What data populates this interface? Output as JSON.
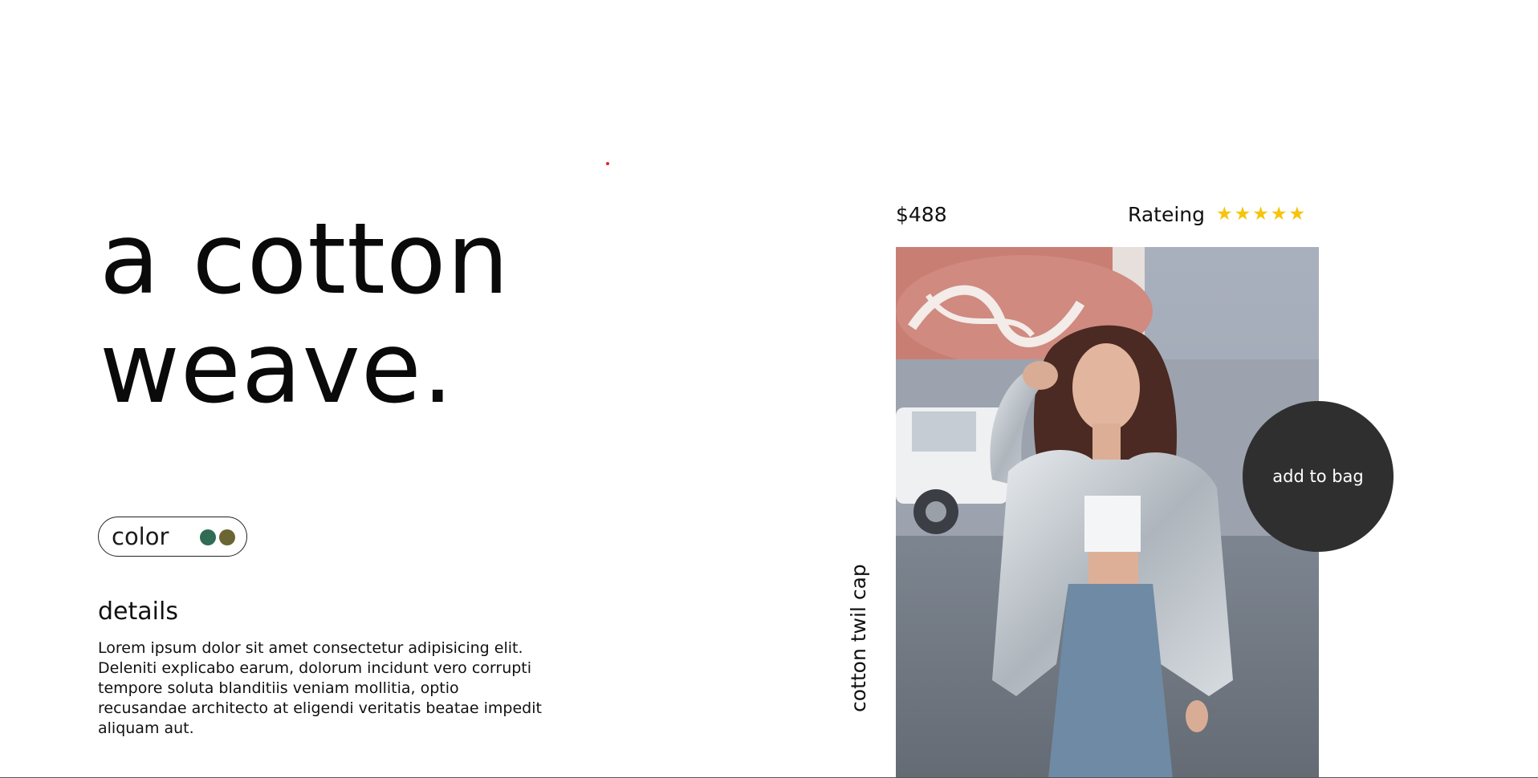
{
  "hero": {
    "title_line1": "a cotton",
    "title_line2": "weave."
  },
  "color_selector": {
    "label": "color",
    "swatches": [
      {
        "name": "green-swatch",
        "color": "#2f6b55"
      },
      {
        "name": "olive-swatch",
        "color": "#6b6433"
      }
    ]
  },
  "details": {
    "heading": "details",
    "body": "Lorem ipsum dolor sit amet consectetur adipisicing elit. Deleniti explicabo earum, dolorum incidunt vero corrupti tempore soluta blanditiis veniam mollitia, optio recusandae architecto at eligendi veritatis beatae impedit aliquam aut."
  },
  "product": {
    "price": "$488",
    "rating_label": "Rateing",
    "rating": 5,
    "rating_max": 5,
    "name_vertical": "cotton twil cap",
    "image_alt": "photo-woman-silver-jacket",
    "add_to_bag": "add to bag"
  },
  "colors": {
    "accent_button": "#2f2f2f",
    "star": "#f6c40c",
    "dot": "#e0242b"
  }
}
